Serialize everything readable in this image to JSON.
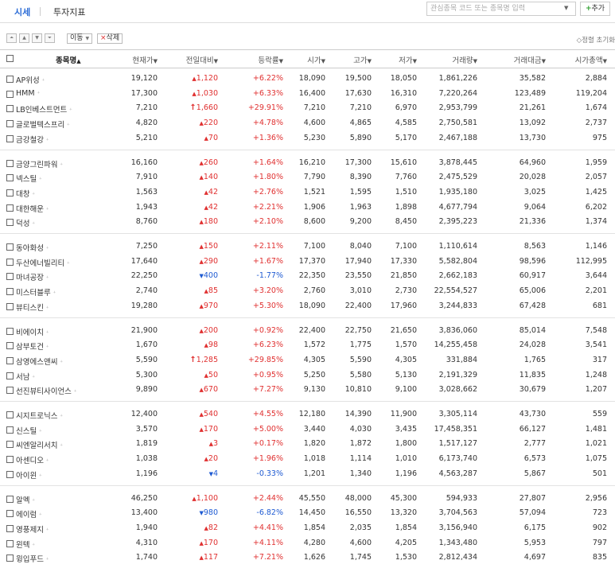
{
  "tabs": [
    {
      "label": "시세",
      "active": true
    },
    {
      "label": "투자지표",
      "active": false
    }
  ],
  "search": {
    "placeholder": "관심종목 코드 또는 종목명 입력"
  },
  "add_button": {
    "plus": "+",
    "label": "추가"
  },
  "toolbar": {
    "move_label": "이동",
    "delete_label": "삭제",
    "sort_label": "◇정렬 초기화"
  },
  "columns": [
    "종목명",
    "현재가",
    "전일대비",
    "등락률",
    "시가",
    "고가",
    "저가",
    "거래량",
    "거래대금",
    "시가총액"
  ],
  "colors": {
    "up": "#e03030",
    "down": "#1e5ad2",
    "accent": "#2a6bd6"
  },
  "rows": [
    {
      "name": "AP위성",
      "price": "19,120",
      "chg_sym": "▲",
      "chg": "1,120",
      "rate": "+6.22%",
      "open": "18,090",
      "high": "19,500",
      "low": "18,050",
      "vol": "1,861,226",
      "amt": "35,582",
      "cap": "2,884",
      "dir": "up"
    },
    {
      "name": "HMM",
      "price": "17,300",
      "chg_sym": "▲",
      "chg": "1,030",
      "rate": "+6.33%",
      "open": "16,400",
      "high": "17,630",
      "low": "16,310",
      "vol": "7,220,264",
      "amt": "123,489",
      "cap": "119,204",
      "dir": "up"
    },
    {
      "name": "LB인베스트먼트",
      "price": "7,210",
      "chg_sym": "↑",
      "chg": "1,660",
      "rate": "+29.91%",
      "open": "7,210",
      "high": "7,210",
      "low": "6,970",
      "vol": "2,953,799",
      "amt": "21,261",
      "cap": "1,674",
      "dir": "up"
    },
    {
      "name": "글로벌텍스프리",
      "price": "4,820",
      "chg_sym": "▲",
      "chg": "220",
      "rate": "+4.78%",
      "open": "4,600",
      "high": "4,865",
      "low": "4,585",
      "vol": "2,750,581",
      "amt": "13,092",
      "cap": "2,737",
      "dir": "up"
    },
    {
      "name": "금강철강",
      "price": "5,210",
      "chg_sym": "▲",
      "chg": "70",
      "rate": "+1.36%",
      "open": "5,230",
      "high": "5,890",
      "low": "5,170",
      "vol": "2,467,188",
      "amt": "13,730",
      "cap": "975",
      "dir": "up"
    },
    {
      "name": "금양그린파워",
      "price": "16,160",
      "chg_sym": "▲",
      "chg": "260",
      "rate": "+1.64%",
      "open": "16,210",
      "high": "17,300",
      "low": "15,610",
      "vol": "3,878,445",
      "amt": "64,960",
      "cap": "1,959",
      "dir": "up"
    },
    {
      "name": "넥스틸",
      "price": "7,910",
      "chg_sym": "▲",
      "chg": "140",
      "rate": "+1.80%",
      "open": "7,790",
      "high": "8,390",
      "low": "7,760",
      "vol": "2,475,529",
      "amt": "20,028",
      "cap": "2,057",
      "dir": "up"
    },
    {
      "name": "대창",
      "price": "1,563",
      "chg_sym": "▲",
      "chg": "42",
      "rate": "+2.76%",
      "open": "1,521",
      "high": "1,595",
      "low": "1,510",
      "vol": "1,935,180",
      "amt": "3,025",
      "cap": "1,425",
      "dir": "up"
    },
    {
      "name": "대한해운",
      "price": "1,943",
      "chg_sym": "▲",
      "chg": "42",
      "rate": "+2.21%",
      "open": "1,906",
      "high": "1,963",
      "low": "1,898",
      "vol": "4,677,794",
      "amt": "9,064",
      "cap": "6,202",
      "dir": "up"
    },
    {
      "name": "덕성",
      "price": "8,760",
      "chg_sym": "▲",
      "chg": "180",
      "rate": "+2.10%",
      "open": "8,600",
      "high": "9,200",
      "low": "8,450",
      "vol": "2,395,223",
      "amt": "21,336",
      "cap": "1,374",
      "dir": "up"
    },
    {
      "name": "동아화성",
      "price": "7,250",
      "chg_sym": "▲",
      "chg": "150",
      "rate": "+2.11%",
      "open": "7,100",
      "high": "8,040",
      "low": "7,100",
      "vol": "1,110,614",
      "amt": "8,563",
      "cap": "1,146",
      "dir": "up"
    },
    {
      "name": "두산에너빌리티",
      "price": "17,640",
      "chg_sym": "▲",
      "chg": "290",
      "rate": "+1.67%",
      "open": "17,370",
      "high": "17,940",
      "low": "17,330",
      "vol": "5,582,804",
      "amt": "98,596",
      "cap": "112,995",
      "dir": "up"
    },
    {
      "name": "마녀공장",
      "price": "22,250",
      "chg_sym": "▼",
      "chg": "400",
      "rate": "-1.77%",
      "open": "22,350",
      "high": "23,550",
      "low": "21,850",
      "vol": "2,662,183",
      "amt": "60,917",
      "cap": "3,644",
      "dir": "down"
    },
    {
      "name": "미스터블루",
      "price": "2,740",
      "chg_sym": "▲",
      "chg": "85",
      "rate": "+3.20%",
      "open": "2,760",
      "high": "3,010",
      "low": "2,730",
      "vol": "22,554,527",
      "amt": "65,006",
      "cap": "2,201",
      "dir": "up"
    },
    {
      "name": "뷰티스킨",
      "price": "19,280",
      "chg_sym": "▲",
      "chg": "970",
      "rate": "+5.30%",
      "open": "18,090",
      "high": "22,400",
      "low": "17,960",
      "vol": "3,244,833",
      "amt": "67,428",
      "cap": "681",
      "dir": "up"
    },
    {
      "name": "비에이치",
      "price": "21,900",
      "chg_sym": "▲",
      "chg": "200",
      "rate": "+0.92%",
      "open": "22,400",
      "high": "22,750",
      "low": "21,650",
      "vol": "3,836,060",
      "amt": "85,014",
      "cap": "7,548",
      "dir": "up"
    },
    {
      "name": "삼부토건",
      "price": "1,670",
      "chg_sym": "▲",
      "chg": "98",
      "rate": "+6.23%",
      "open": "1,572",
      "high": "1,775",
      "low": "1,570",
      "vol": "14,255,458",
      "amt": "24,028",
      "cap": "3,541",
      "dir": "up"
    },
    {
      "name": "삼영에스앤씨",
      "price": "5,590",
      "chg_sym": "↑",
      "chg": "1,285",
      "rate": "+29.85%",
      "open": "4,305",
      "high": "5,590",
      "low": "4,305",
      "vol": "331,884",
      "amt": "1,765",
      "cap": "317",
      "dir": "up"
    },
    {
      "name": "서남",
      "price": "5,300",
      "chg_sym": "▲",
      "chg": "50",
      "rate": "+0.95%",
      "open": "5,250",
      "high": "5,580",
      "low": "5,130",
      "vol": "2,191,329",
      "amt": "11,835",
      "cap": "1,248",
      "dir": "up"
    },
    {
      "name": "선진뷰티사이언스",
      "price": "9,890",
      "chg_sym": "▲",
      "chg": "670",
      "rate": "+7.27%",
      "open": "9,130",
      "high": "10,810",
      "low": "9,100",
      "vol": "3,028,662",
      "amt": "30,679",
      "cap": "1,207",
      "dir": "up"
    },
    {
      "name": "시지트로닉스",
      "price": "12,400",
      "chg_sym": "▲",
      "chg": "540",
      "rate": "+4.55%",
      "open": "12,180",
      "high": "14,390",
      "low": "11,900",
      "vol": "3,305,114",
      "amt": "43,730",
      "cap": "559",
      "dir": "up"
    },
    {
      "name": "신스틸",
      "price": "3,570",
      "chg_sym": "▲",
      "chg": "170",
      "rate": "+5.00%",
      "open": "3,440",
      "high": "4,030",
      "low": "3,435",
      "vol": "17,458,351",
      "amt": "66,127",
      "cap": "1,481",
      "dir": "up"
    },
    {
      "name": "씨엔알리서치",
      "price": "1,819",
      "chg_sym": "▲",
      "chg": "3",
      "rate": "+0.17%",
      "open": "1,820",
      "high": "1,872",
      "low": "1,800",
      "vol": "1,517,127",
      "amt": "2,777",
      "cap": "1,021",
      "dir": "up"
    },
    {
      "name": "아센디오",
      "price": "1,038",
      "chg_sym": "▲",
      "chg": "20",
      "rate": "+1.96%",
      "open": "1,018",
      "high": "1,114",
      "low": "1,010",
      "vol": "6,173,740",
      "amt": "6,573",
      "cap": "1,075",
      "dir": "up"
    },
    {
      "name": "아이윈",
      "price": "1,196",
      "chg_sym": "▼",
      "chg": "4",
      "rate": "-0.33%",
      "open": "1,201",
      "high": "1,340",
      "low": "1,196",
      "vol": "4,563,287",
      "amt": "5,867",
      "cap": "501",
      "dir": "down"
    },
    {
      "name": "알멕",
      "price": "46,250",
      "chg_sym": "▲",
      "chg": "1,100",
      "rate": "+2.44%",
      "open": "45,550",
      "high": "48,000",
      "low": "45,300",
      "vol": "594,933",
      "amt": "27,807",
      "cap": "2,956",
      "dir": "up"
    },
    {
      "name": "에이럼",
      "price": "13,400",
      "chg_sym": "▼",
      "chg": "980",
      "rate": "-6.82%",
      "open": "14,450",
      "high": "16,550",
      "low": "13,320",
      "vol": "3,704,563",
      "amt": "57,094",
      "cap": "723",
      "dir": "down"
    },
    {
      "name": "영풍제지",
      "price": "1,940",
      "chg_sym": "▲",
      "chg": "82",
      "rate": "+4.41%",
      "open": "1,854",
      "high": "2,035",
      "low": "1,854",
      "vol": "3,156,940",
      "amt": "6,175",
      "cap": "902",
      "dir": "up"
    },
    {
      "name": "윈텍",
      "price": "4,310",
      "chg_sym": "▲",
      "chg": "170",
      "rate": "+4.11%",
      "open": "4,280",
      "high": "4,600",
      "low": "4,205",
      "vol": "1,343,480",
      "amt": "5,953",
      "cap": "797",
      "dir": "up"
    },
    {
      "name": "윙입푸드",
      "price": "1,740",
      "chg_sym": "▲",
      "chg": "117",
      "rate": "+7.21%",
      "open": "1,626",
      "high": "1,745",
      "low": "1,530",
      "vol": "2,812,434",
      "amt": "4,697",
      "cap": "835",
      "dir": "up"
    }
  ]
}
